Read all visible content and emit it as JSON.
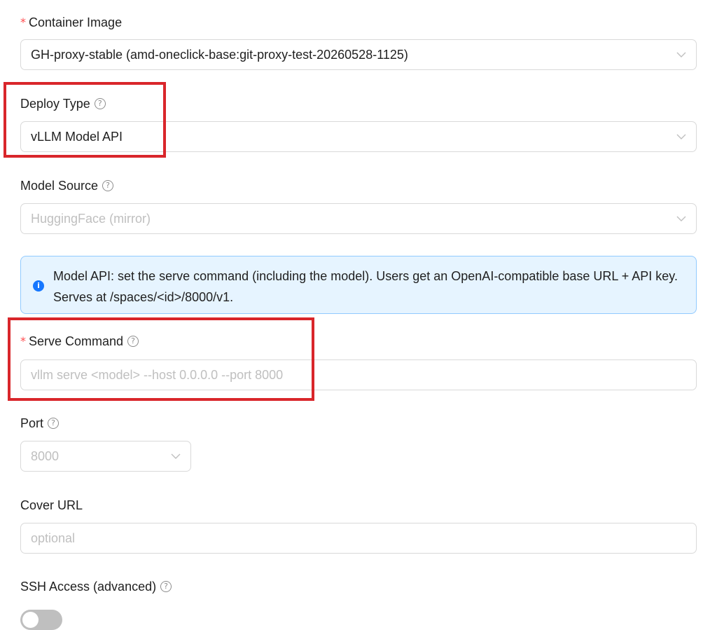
{
  "form": {
    "container_image": {
      "label": "Container Image",
      "value": "GH-proxy-stable (amd-oneclick-base:git-proxy-test-20260528-1125)",
      "required": true
    },
    "deploy_type": {
      "label": "Deploy Type",
      "value": "vLLM Model API"
    },
    "model_source": {
      "label": "Model Source",
      "value": "HuggingFace (mirror)"
    },
    "info_alert": {
      "text": "Model API: set the serve command (including the model). Users get an OpenAI-compatible base URL + API key. Serves at /spaces/<id>/8000/v1."
    },
    "serve_command": {
      "label": "Serve Command",
      "placeholder": "vllm serve <model> --host 0.0.0.0 --port 8000",
      "required": true
    },
    "port": {
      "label": "Port",
      "value": "8000"
    },
    "cover_url": {
      "label": "Cover URL",
      "placeholder": "optional"
    },
    "ssh_access": {
      "label": "SSH Access (advanced)",
      "enabled": false
    }
  },
  "symbols": {
    "required_mark": "*",
    "help": "?",
    "info": "i"
  },
  "colors": {
    "highlight": "#d9262b",
    "required": "#ff4d4f",
    "info_bg": "#e6f4ff",
    "info_border": "#91caff",
    "info_icon": "#1677ff",
    "placeholder": "#bfbfbf"
  }
}
